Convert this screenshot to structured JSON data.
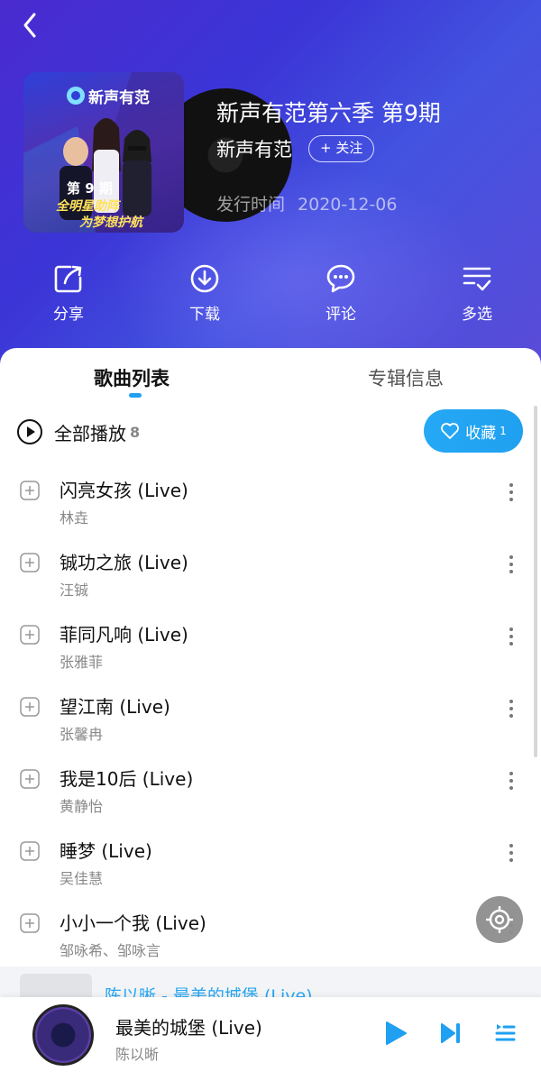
{
  "header": {
    "album_title": "新声有范第六季 第9期",
    "artist": "新声有范",
    "follow_label": "+ 关注",
    "release_label": "发行时间",
    "release_date": "2020-12-06"
  },
  "cover": {
    "show_name": "新声有范",
    "episode": "第 9 期",
    "slogan_1": "全明星助阵",
    "slogan_2": "为梦想护航"
  },
  "actions": [
    {
      "label": "分享",
      "icon": "share-icon"
    },
    {
      "label": "下载",
      "icon": "download-icon"
    },
    {
      "label": "评论",
      "icon": "comment-icon"
    },
    {
      "label": "多选",
      "icon": "multi-select-icon"
    }
  ],
  "tabs": {
    "songs": "歌曲列表",
    "info": "专辑信息"
  },
  "play_all": {
    "label": "全部播放",
    "count": "8"
  },
  "favorite": {
    "label": "收藏",
    "count": "1"
  },
  "songs": [
    {
      "title": "闪亮女孩 (Live)",
      "artist": "林垚"
    },
    {
      "title": "铖功之旅 (Live)",
      "artist": "汪铖"
    },
    {
      "title": "菲同凡响 (Live)",
      "artist": "张雅菲"
    },
    {
      "title": "望江南 (Live)",
      "artist": "张馨冉"
    },
    {
      "title": "我是10后 (Live)",
      "artist": "黄静怡"
    },
    {
      "title": "睡梦 (Live)",
      "artist": "吴佳慧"
    },
    {
      "title": "小小一个我 (Live)",
      "artist": "邹咏希、邹咏言"
    }
  ],
  "peek_text": "陈以晰 - 最美的城堡 (Live)",
  "now_playing": {
    "title": "最美的城堡 (Live)",
    "artist": "陈以晰"
  },
  "colors": {
    "accent": "#1fa0f0",
    "hero_start": "#4a2bd0",
    "hero_end": "#5a4bd8"
  }
}
